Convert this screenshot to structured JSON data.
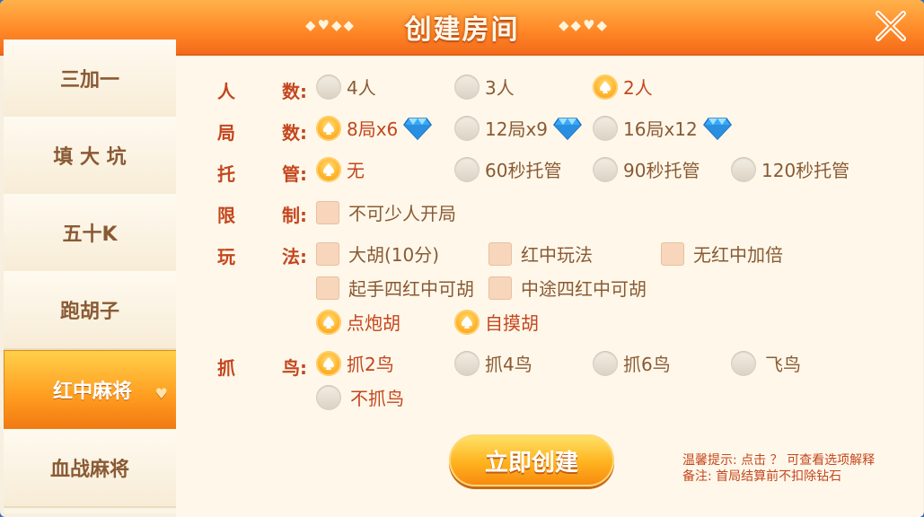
{
  "title": "创建房间",
  "decor_left": "◆♥◆◆",
  "decor_right": "◆◆♥◆",
  "sidebar": {
    "items": [
      {
        "label": "三加一"
      },
      {
        "label": "填 大 坑"
      },
      {
        "label": "五十K"
      },
      {
        "label": "跑胡子"
      },
      {
        "label": "红中麻将",
        "active": true
      },
      {
        "label": "血战麻将"
      }
    ]
  },
  "rows": {
    "players": {
      "label_a": "人",
      "label_b": "数:",
      "options": [
        "4人",
        "3人",
        "2人"
      ],
      "selected": "2人"
    },
    "rounds": {
      "label_a": "局",
      "label_b": "数:",
      "options": [
        "8局x6",
        "12局x9",
        "16局x12"
      ],
      "selected": "8局x6"
    },
    "hosting": {
      "label_a": "托",
      "label_b": "管:",
      "options": [
        "无",
        "60秒托管",
        "90秒托管",
        "120秒托管"
      ],
      "selected": "无"
    },
    "limit": {
      "label_a": "限",
      "label_b": "制:",
      "options": [
        "不可少人开局"
      ]
    },
    "play": {
      "label_a": "玩",
      "label_b": "法:",
      "checks": [
        "大胡(10分)",
        "红中玩法",
        "无红中加倍",
        "起手四红中可胡",
        "中途四红中可胡"
      ],
      "win_options": [
        "点炮胡",
        "自摸胡"
      ],
      "win_selected": [
        "点炮胡",
        "自摸胡"
      ]
    },
    "birds": {
      "label_a": "抓",
      "label_b": "鸟:",
      "options": [
        "抓2鸟",
        "抓4鸟",
        "抓6鸟",
        "飞鸟",
        "不抓鸟"
      ],
      "selected": "抓2鸟"
    }
  },
  "create_button": "立即创建",
  "tips": {
    "line1": "温馨提示: 点击 ？ 可查看选项解释",
    "line2": "备注: 首局结算前不扣除钻石"
  },
  "colors": {
    "accent": "#ff8a28",
    "label_red": "#c4461e",
    "text_brown": "#8a5a34"
  },
  "icons": {
    "close": "close-icon",
    "diamond": "diamond-icon",
    "spade": "spade-icon"
  }
}
